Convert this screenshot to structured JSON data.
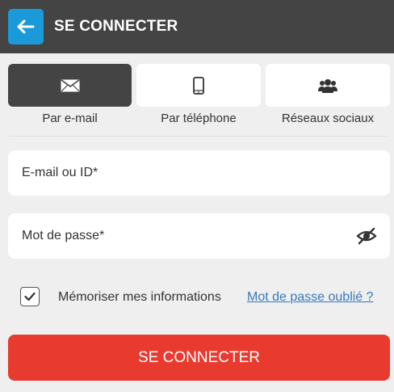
{
  "header": {
    "title": "SE CONNECTER",
    "back_icon": "arrow-left-icon",
    "background": "#444444",
    "back_color": "#1a9ad9"
  },
  "tabs": [
    {
      "label": "Par e-mail",
      "icon": "envelope-icon",
      "active": true
    },
    {
      "label": "Par téléphone",
      "icon": "phone-icon",
      "active": false
    },
    {
      "label": "Réseaux sociaux",
      "icon": "users-icon",
      "active": false
    }
  ],
  "form": {
    "email_placeholder": "E-mail ou ID*",
    "password_placeholder": "Mot de passe*",
    "password_toggle_icon": "eye-slash-icon",
    "remember_label": "Mémoriser mes informations",
    "remember_checked": true,
    "forgot_link": "Mot de passe oublié ?",
    "submit_label": "SE CONNECTER",
    "submit_color": "#e83a2f"
  }
}
